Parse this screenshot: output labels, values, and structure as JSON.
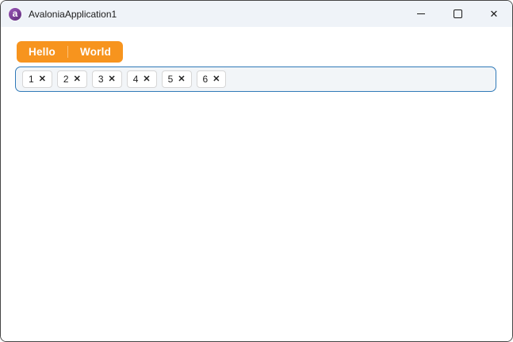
{
  "window": {
    "title": "AvaloniaApplication1",
    "icon_letter": "a",
    "controls": {
      "minimize_icon": "minimize-dash",
      "maximize_icon": "maximize-square",
      "close_glyph": "✕"
    }
  },
  "tabs": {
    "items": [
      {
        "label": "Hello"
      },
      {
        "label": "World"
      }
    ]
  },
  "chipbar": {
    "items": [
      {
        "value": "1",
        "remove": "✕"
      },
      {
        "value": "2",
        "remove": "✕"
      },
      {
        "value": "3",
        "remove": "✕"
      },
      {
        "value": "4",
        "remove": "✕"
      },
      {
        "value": "5",
        "remove": "✕"
      },
      {
        "value": "6",
        "remove": "✕"
      }
    ]
  },
  "colors": {
    "accent_orange": "#f7941e",
    "chipbar_border": "#2f79b8",
    "chipbar_bg": "#f2f5f8",
    "titlebar_bg": "#eff3f8",
    "avalonia_purple": "#7b3f98",
    "window_border": "#454545"
  }
}
